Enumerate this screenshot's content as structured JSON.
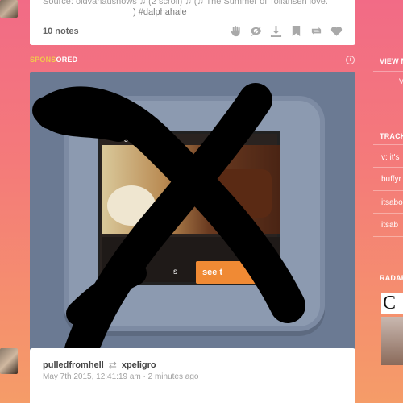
{
  "post": {
    "source_text": "Source: oldvanaushows ♫ (2 scroll) ♫ (♫ The Summer of Tollahseh love.",
    "tags": ") #dalphahale",
    "notes": "10 notes"
  },
  "actions": [
    "hand-icon",
    "share-icon",
    "download-icon",
    "bookmark-icon",
    "reblog-icon",
    "like-icon"
  ],
  "sponsored": {
    "label_hi": "SPONS",
    "label_rest": "ORED"
  },
  "ad": {
    "logo": "ocial",
    "side_text": "s",
    "cta": "see t"
  },
  "reblog": {
    "from": "pulledfromhell",
    "to": "xpeligro",
    "timestamp": "May 7th 2015, 12:41:19 am · 2 minutes ago"
  },
  "sidebar": {
    "view_label": "VIEW M",
    "view_sub": "V",
    "tracked_label": "TRACK",
    "tracked_items": [
      "v: it's",
      "buffyr",
      "itsabo",
      "itsab"
    ],
    "radar_label": "RADAR",
    "radar_letter": "C"
  },
  "colors": {
    "accent": "#f2c94c",
    "ad_bg": "#6b7a93",
    "cta": "#f08a34"
  }
}
